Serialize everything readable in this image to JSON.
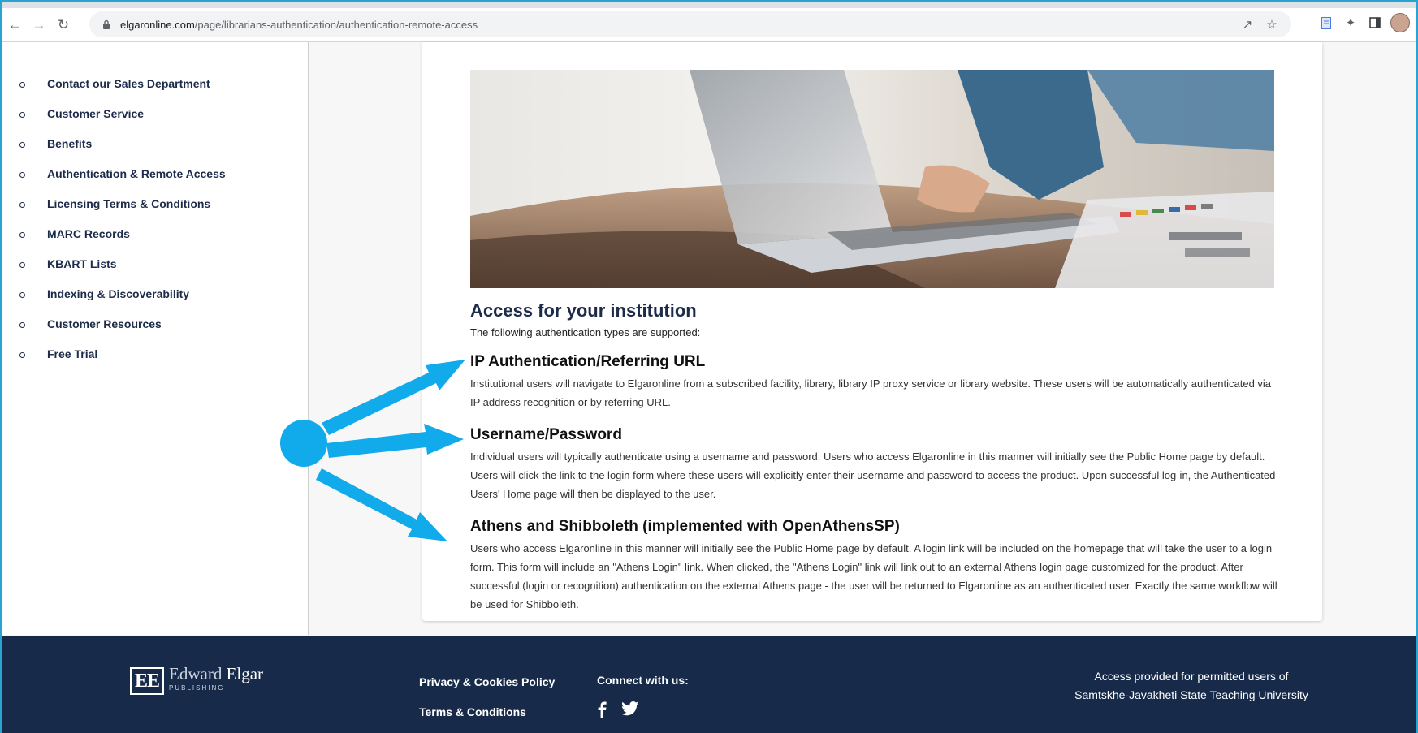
{
  "browser": {
    "url_host": "elgaronline.com",
    "url_path": "/page/librarians-authentication/authentication-remote-access"
  },
  "sidebar": {
    "items": [
      {
        "label": "Contact our Sales Department"
      },
      {
        "label": "Customer Service"
      },
      {
        "label": "Benefits"
      },
      {
        "label": "Authentication & Remote Access"
      },
      {
        "label": "Licensing Terms & Conditions"
      },
      {
        "label": "MARC Records"
      },
      {
        "label": "KBART Lists"
      },
      {
        "label": "Indexing & Discoverability"
      },
      {
        "label": "Customer Resources"
      },
      {
        "label": "Free Trial"
      }
    ]
  },
  "main": {
    "title": "Access for your institution",
    "intro": "The following authentication types are supported:",
    "methods": [
      {
        "title": "IP Authentication/Referring URL",
        "text": "Institutional users will navigate to Elgaronline from a subscribed facility, library, library IP proxy service or library website. These users will be automatically authenticated via IP address recognition or by referring URL."
      },
      {
        "title": "Username/Password",
        "text": "Individual users will typically authenticate using a username and password. Users who access Elgaronline in this manner will initially see the Public Home page by default. Users will click the link to the login form where these users will explicitly enter their username and password to access the product. Upon successful log-in, the Authenticated Users' Home page will then be displayed to the user."
      },
      {
        "title": "Athens and Shibboleth (implemented with OpenAthensSP)",
        "text": "Users who access Elgaronline in this manner will initially see the Public Home page by default. A login link will be included on the homepage that will take the user to a login form. This form will include an \"Athens Login\" link. When clicked, the \"Athens Login\" link will link out to an external Athens login page customized for the product. After successful (login or recognition) authentication on the external Athens page - the user will be returned to Elgaronline as an authenticated user. Exactly the same workflow will be used for Shibboleth."
      }
    ]
  },
  "footer": {
    "logo_mark": "EE",
    "logo_name_light": "Edward",
    "logo_name_bold": "Elgar",
    "logo_sub": "PUBLISHING",
    "privacy": "Privacy & Cookies Policy",
    "terms": "Terms & Conditions",
    "connect": "Connect with us:",
    "access_line1": "Access provided for permitted users of",
    "access_line2": "Samtskhe-Javakheti State Teaching University"
  },
  "colors": {
    "navy": "#1d2b4a",
    "footer_bg": "#172a4a",
    "annotation": "#11aaeb"
  }
}
